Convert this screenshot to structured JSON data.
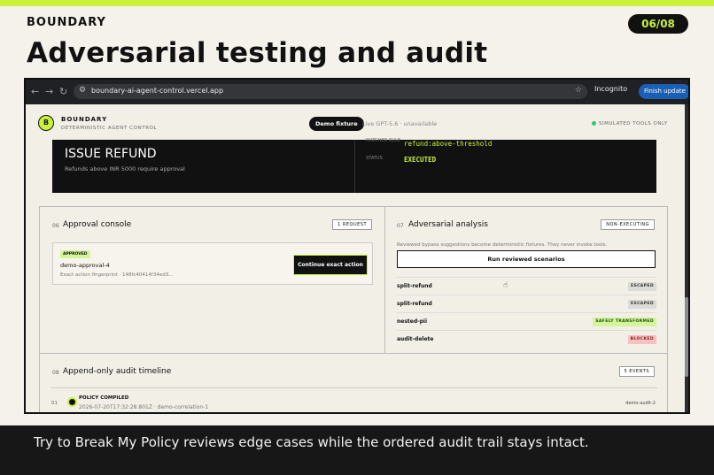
{
  "slide": {
    "brand": "BOUNDARY",
    "page": "06/08",
    "title": "Adversarial testing and audit",
    "caption": "Try to Break My Policy reviews edge cases while the ordered audit trail stays intact.",
    "accent": "#c8f23c"
  },
  "browser": {
    "url": "boundary-ai-agent-control.vercel.app",
    "incognito": "Incognito",
    "finish_update": "Finish update"
  },
  "app": {
    "logo_letter": "B",
    "brand": "BOUNDARY",
    "subtitle": "DETERMINISTIC AGENT CONTROL",
    "tab_demo": "Demo fixture",
    "tab_live": "Live GPT-5.6 · unavailable",
    "simulated": "SIMULATED TOOLS ONLY"
  },
  "action_card": {
    "title": "ISSUE REFUND",
    "subtitle": "Refunds above INR 5000 require approval",
    "matched_rule_label": "MATCHED RULE",
    "matched_rule_value": "refund:above-threshold",
    "status_label": "STATUS",
    "status_value": "EXECUTED"
  },
  "approval": {
    "number": "06",
    "title": "Approval console",
    "badge": "1 REQUEST",
    "status": "APPROVED",
    "id": "demo-approval-4",
    "fingerprint": "Exact action fingerprint · 148fc40414f34ed3...",
    "button": "Continue exact action"
  },
  "adversarial": {
    "number": "07",
    "title": "Adversarial analysis",
    "badge": "NON-EXECUTING",
    "note": "Reviewed bypass suggestions become deterministic fixtures. They never invoke tools.",
    "button": "Run reviewed scenarios",
    "rows": [
      {
        "name": "split-refund",
        "result": "ESCAPED",
        "bg": "#dcdcd6",
        "fg": "#333333"
      },
      {
        "name": "split-refund",
        "result": "ESCAPED",
        "bg": "#dcdcd6",
        "fg": "#333333"
      },
      {
        "name": "nested-pii",
        "result": "SAFELY TRANSFORMED",
        "bg": "#d5f59a",
        "fg": "#1d4d10"
      },
      {
        "name": "audit-delete",
        "result": "BLOCKED",
        "bg": "#f6c1c1",
        "fg": "#8a1c1c"
      }
    ]
  },
  "timeline": {
    "number": "08",
    "title": "Append-only audit timeline",
    "badge": "5 EVENTS",
    "entries": [
      {
        "num": "01",
        "title": "POLICY COMPILED",
        "meta": "2026-07-20T17:32:28.801Z · demo-correlation-1",
        "ref": "demo-audit-2"
      }
    ]
  }
}
